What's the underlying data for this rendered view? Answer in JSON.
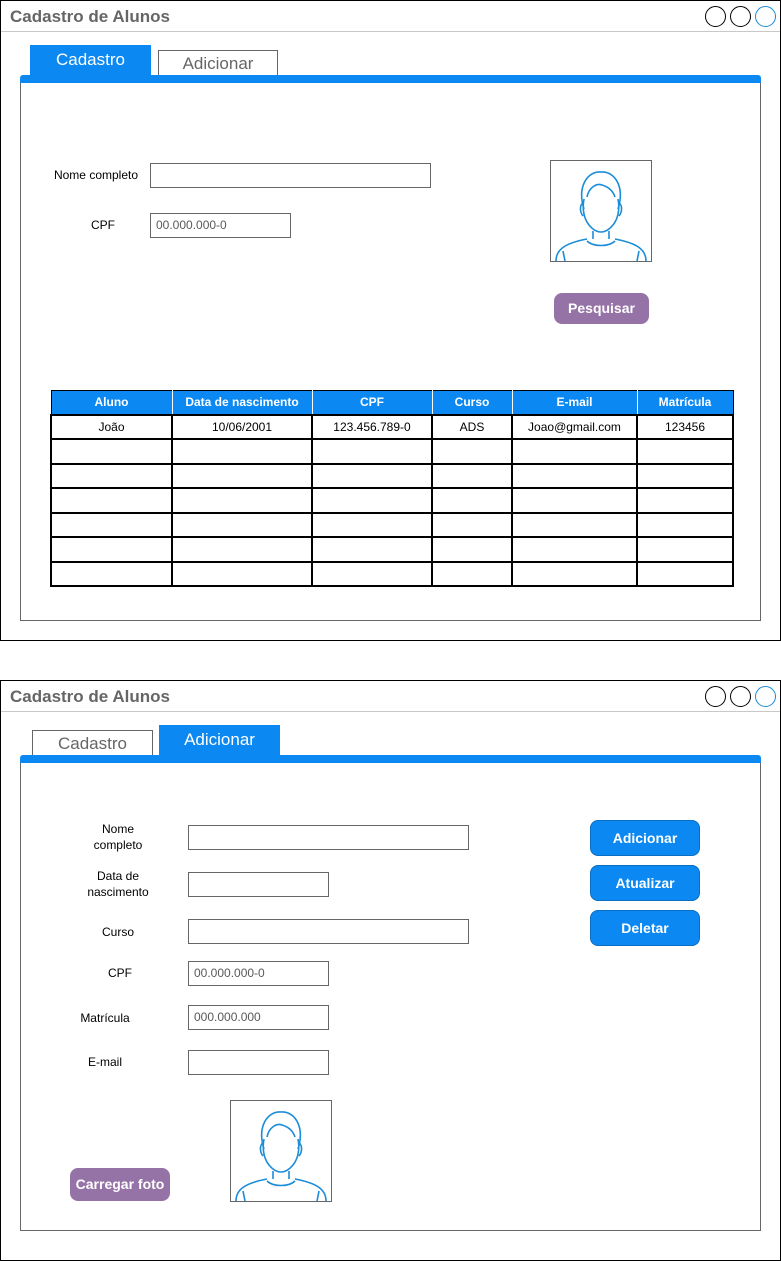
{
  "window_title": "Cadastro de Alunos",
  "tabs": {
    "cadastro": "Cadastro",
    "adicionar": "Adicionar"
  },
  "search_screen": {
    "nome_label": "Nome completo",
    "nome_value": "",
    "cpf_label": "CPF",
    "cpf_placeholder": "00.000.000-0",
    "search_button": "Pesquisar",
    "table": {
      "headers": [
        "Aluno",
        "Data de nascimento",
        "CPF",
        "Curso",
        "E-mail",
        "Matrícula"
      ],
      "rows": [
        [
          "João",
          "10/06/2001",
          "123.456.789-0",
          "ADS",
          "Joao@gmail.com",
          "123456"
        ],
        [
          "",
          "",
          "",
          "",
          "",
          ""
        ],
        [
          "",
          "",
          "",
          "",
          "",
          ""
        ],
        [
          "",
          "",
          "",
          "",
          "",
          ""
        ],
        [
          "",
          "",
          "",
          "",
          "",
          ""
        ],
        [
          "",
          "",
          "",
          "",
          "",
          ""
        ],
        [
          "",
          "",
          "",
          "",
          "",
          ""
        ]
      ]
    }
  },
  "add_screen": {
    "nome_label_1": "Nome",
    "nome_label_2": "completo",
    "nascimento_label_1": "Data de",
    "nascimento_label_2": "nascimento",
    "curso_label": "Curso",
    "cpf_label": "CPF",
    "cpf_placeholder": "00.000.000-0",
    "matricula_label": "Matrícula",
    "matricula_placeholder": "000.000.000",
    "email_label": "E-mail",
    "add_button": "Adicionar",
    "update_button": "Atualizar",
    "delete_button": "Deletar",
    "upload_button": "Carregar foto"
  },
  "icons": {
    "window_controls": [
      "circle-icon",
      "circle-icon",
      "circle-icon"
    ],
    "photo": "user-avatar-icon"
  },
  "colors": {
    "accent": "#0b88f2",
    "purple_button": "#9673a6",
    "avatar_stroke": "#1a8cd8",
    "title_text": "#666666"
  }
}
